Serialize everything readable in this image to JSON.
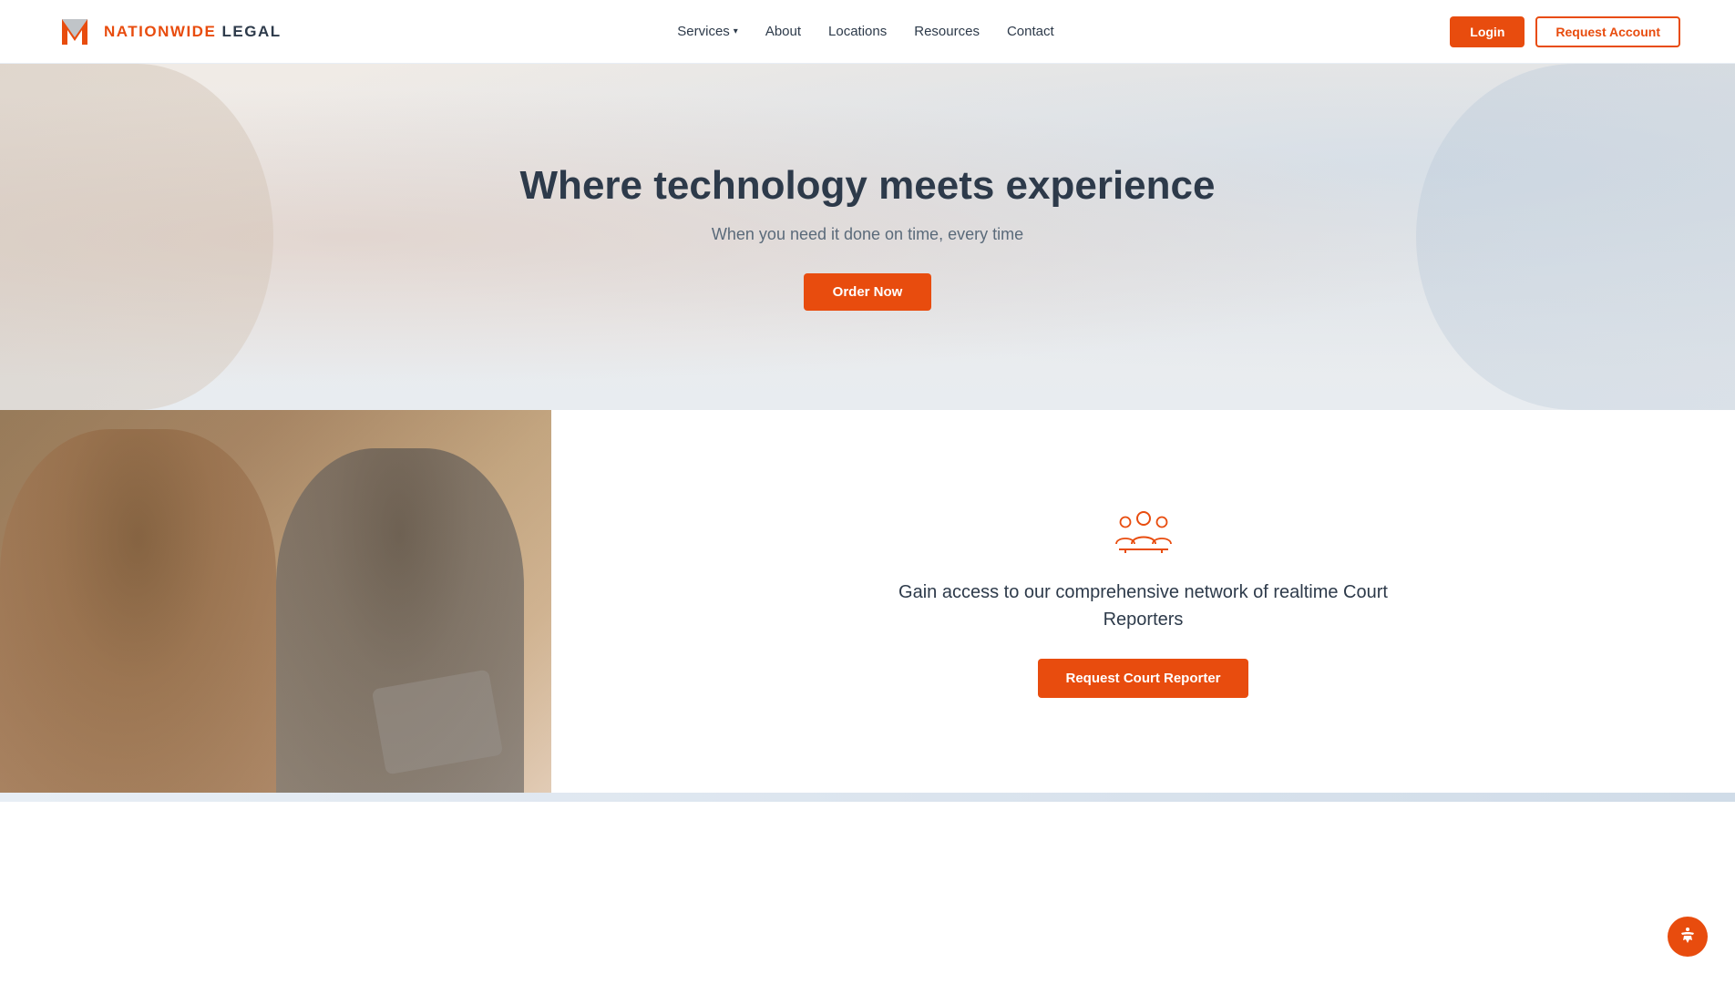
{
  "header": {
    "logo_nationwide": "NATIONWIDE",
    "logo_legal": "LEGAL",
    "nav": {
      "services": "Services",
      "about": "About",
      "locations": "Locations",
      "resources": "Resources",
      "contact": "Contact"
    },
    "login_label": "Login",
    "request_account_label": "Request Account"
  },
  "hero": {
    "title": "Where technology meets experience",
    "subtitle": "When you need it done on time, every time",
    "order_now_label": "Order Now"
  },
  "court_reporter": {
    "text": "Gain access to our comprehensive network of realtime Court Reporters",
    "button_label": "Request Court Reporter"
  },
  "accessibility": {
    "label": "Accessibility"
  }
}
